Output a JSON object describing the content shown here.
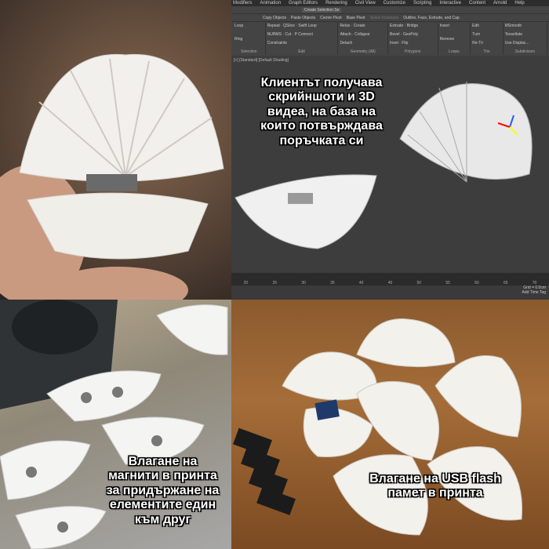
{
  "captions": {
    "top_right": [
      "Клиентът получава",
      "скрийншоти и 3D",
      "видеа, на база на",
      "които потвърждава",
      "поръчката си"
    ],
    "bottom_left": [
      "Влагане на",
      "магнити в принта",
      "за придържане на",
      "елементите един",
      "към друг"
    ],
    "bottom_right": [
      "Влагане на USB flash",
      "памет в принта"
    ]
  },
  "max_ui": {
    "menu": [
      "Modifiers",
      "Animation",
      "Graph Editors",
      "Rendering",
      "Civil View",
      "Customize",
      "Scripting",
      "Interactive",
      "Content",
      "Arnold",
      "Help"
    ],
    "toolbar": {
      "selection_set": "Create Selection Se",
      "copy": "Copy Objects",
      "paste": "Paste Objects",
      "center_pivot": "Center Pivot",
      "base_pivot": "Base Pivot",
      "select_instances": "Select Instances",
      "outline": "Outline, Face, Extrude, and Cap"
    },
    "ribbon_groups": [
      {
        "title": "Selection",
        "items": [
          "Loop",
          "Ring"
        ]
      },
      {
        "title": "Edit",
        "items": [
          "Repeat",
          "QSlice",
          "Swift Loop",
          "NURMS",
          "Cut",
          "P Connect",
          "Constraints"
        ]
      },
      {
        "title": "Geometry (All)",
        "items": [
          "Relax",
          "Create",
          "Attach",
          "Collapse",
          "Detach"
        ]
      },
      {
        "title": "Polygons",
        "items": [
          "Extrude",
          "Bridge",
          "Bevel",
          "GeoPoly",
          "Inset",
          "Flip"
        ]
      },
      {
        "title": "Loops",
        "items": [
          "Insert",
          "Remove"
        ]
      },
      {
        "title": "Tris",
        "items": [
          "Edit",
          "Turn",
          "Re-Tri"
        ]
      },
      {
        "title": "Subdivision",
        "items": [
          "MSmooth",
          "Tessellate",
          "Use Displac..."
        ]
      }
    ],
    "viewport_label": "[+] [Standard] [Default Shading]",
    "timeline_ticks": [
      "20",
      "25",
      "30",
      "35",
      "40",
      "45",
      "50",
      "55",
      "60",
      "65",
      "70"
    ],
    "grid": "Grid = 0.0cm",
    "add_time_tag": "Add Time Tag"
  }
}
